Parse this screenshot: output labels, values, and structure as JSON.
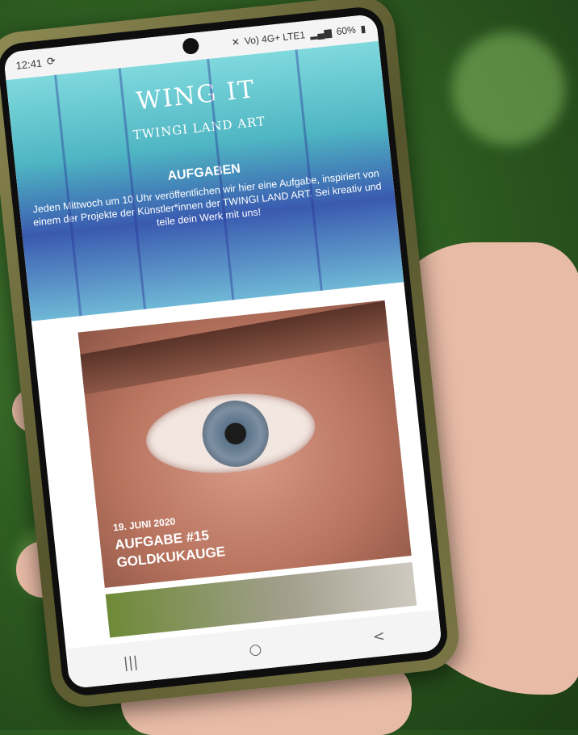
{
  "status": {
    "time": "12:41",
    "battery": "60%",
    "network": "Vo) 4G+ LTE1"
  },
  "hero": {
    "title": "WING IT",
    "subtitle": "TWINGI LAND ART",
    "section": "AUFGABEN",
    "description": "Jeden Mittwoch um 10 Uhr veröffentlichen wir hier eine Aufgabe, inspiriert von einem der Projekte der Künstler*innen der TWINGI LAND ART. Sei kreativ und teile dein Werk mit uns!"
  },
  "card": {
    "date": "19. JUNI 2020",
    "title_line1": "AUFGABE #15",
    "title_line2": "GOLDKUKAUGE"
  },
  "navbar": {
    "recent": "|||",
    "home": "○",
    "back": "<"
  }
}
